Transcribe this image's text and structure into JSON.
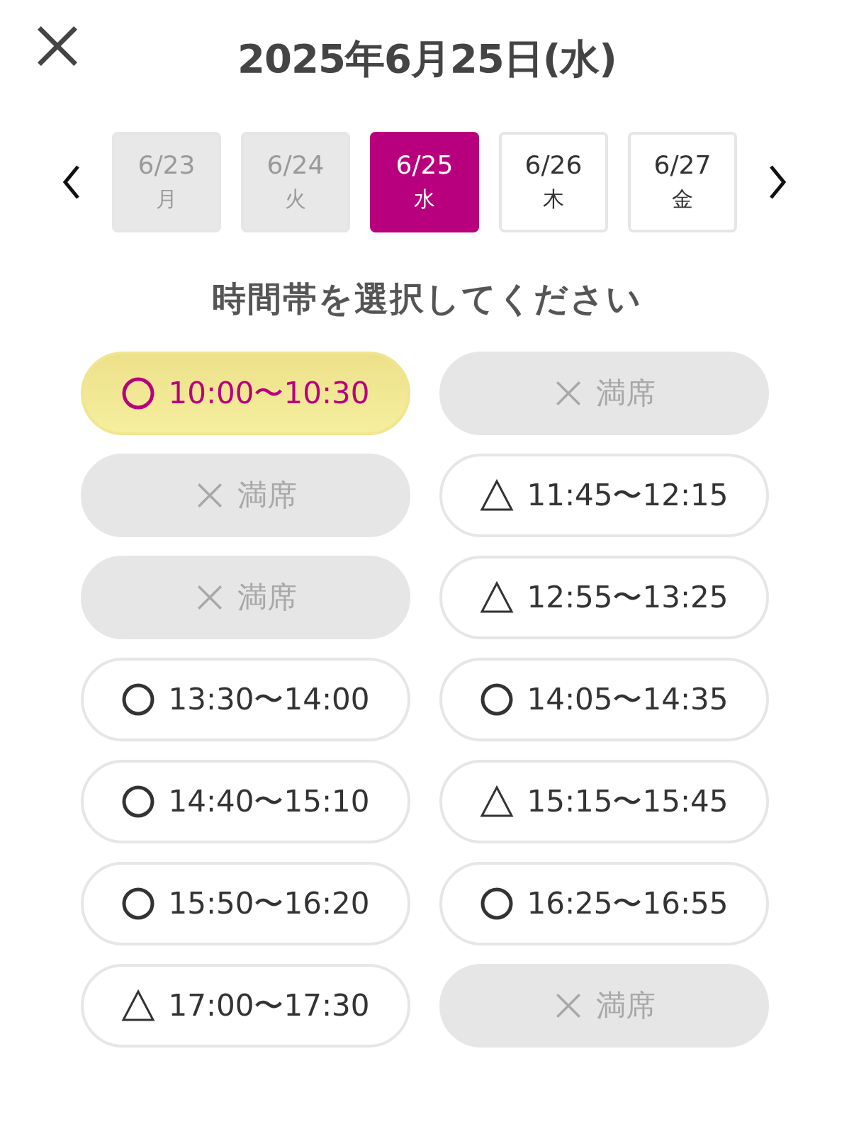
{
  "header": {
    "title": "2025年6月25日(水)"
  },
  "date_tabs": [
    {
      "date": "6/23",
      "weekday": "月",
      "disabled": true,
      "selected": false
    },
    {
      "date": "6/24",
      "weekday": "火",
      "disabled": true,
      "selected": false
    },
    {
      "date": "6/25",
      "weekday": "水",
      "disabled": false,
      "selected": true
    },
    {
      "date": "6/26",
      "weekday": "木",
      "disabled": false,
      "selected": false
    },
    {
      "date": "6/27",
      "weekday": "金",
      "disabled": false,
      "selected": false
    }
  ],
  "heading": "時間帯を選択してください",
  "slots": [
    {
      "kind": "available",
      "label": "10:00〜10:30",
      "selected": true
    },
    {
      "kind": "full",
      "label": "満席",
      "selected": false
    },
    {
      "kind": "full",
      "label": "満席",
      "selected": false
    },
    {
      "kind": "few",
      "label": "11:45〜12:15",
      "selected": false
    },
    {
      "kind": "full",
      "label": "満席",
      "selected": false
    },
    {
      "kind": "few",
      "label": "12:55〜13:25",
      "selected": false
    },
    {
      "kind": "available",
      "label": "13:30〜14:00",
      "selected": false
    },
    {
      "kind": "available",
      "label": "14:05〜14:35",
      "selected": false
    },
    {
      "kind": "available",
      "label": "14:40〜15:10",
      "selected": false
    },
    {
      "kind": "few",
      "label": "15:15〜15:45",
      "selected": false
    },
    {
      "kind": "available",
      "label": "15:50〜16:20",
      "selected": false
    },
    {
      "kind": "available",
      "label": "16:25〜16:55",
      "selected": false
    },
    {
      "kind": "few",
      "label": "17:00〜17:30",
      "selected": false
    },
    {
      "kind": "full",
      "label": "満席",
      "selected": false
    }
  ]
}
